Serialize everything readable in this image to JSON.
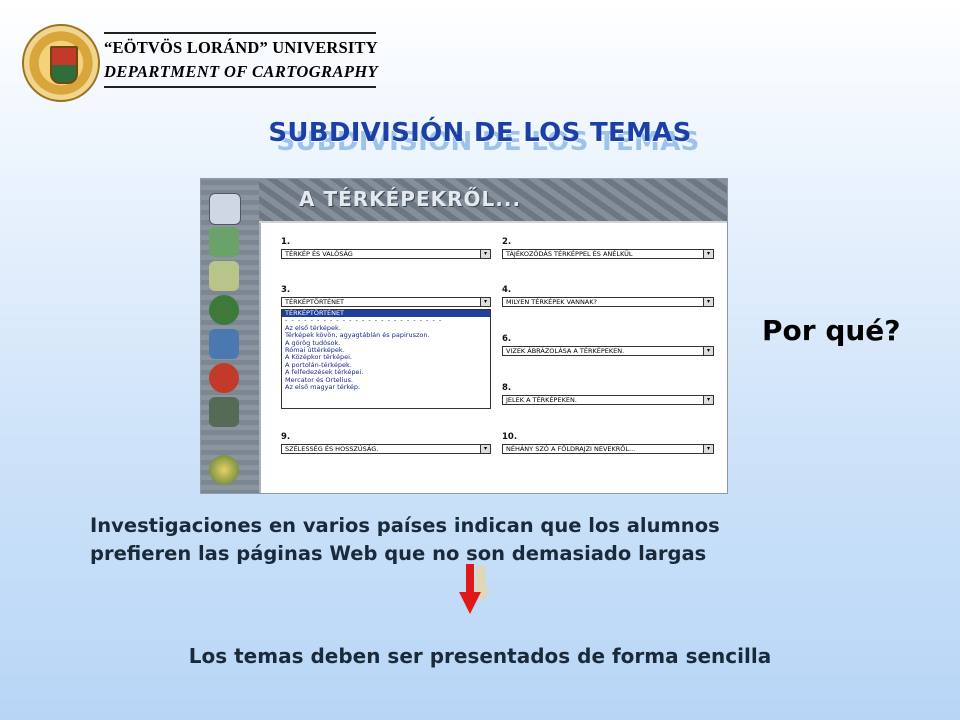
{
  "header": {
    "university": "“EÖTVÖS LORÁND” UNIVERSITY",
    "department": "DEPARTMENT OF CARTOGRAPHY"
  },
  "slide": {
    "title": "SUBDIVISIÓN DE LOS TEMAS",
    "side_question": "Por qué?",
    "paragraph_line1": "Investigaciones en varios países indican que los alumnos",
    "paragraph_line2": "prefieren las páginas Web que no son demasiado largas",
    "conclusion": "Los temas deben ser presentados de forma sencilla"
  },
  "screenshot": {
    "banner": "A TÉRKÉPEKRŐL...",
    "fields": [
      {
        "num": "1.",
        "value": "TÉRKÉP ÉS VALÓSÁG"
      },
      {
        "num": "2.",
        "value": "TÁJÉKOZÓDÁS TÉRKÉPPEL ÉS ANÉLKÜL"
      },
      {
        "num": "3.",
        "value": "TÉRKÉPTÖRTÉNET"
      },
      {
        "num": "4.",
        "value": "MILYEN TÉRKÉPEK VANNAK?"
      },
      {
        "num": "6.",
        "value": "VIZEK ÁBRÁZOLÁSA A TÉRKÉPEKEN."
      },
      {
        "num": "8.",
        "value": "JELEK A TÉRKÉPEKEN."
      },
      {
        "num": "9.",
        "value": "SZÉLESSÉG ÉS HOSSZÚSÁG."
      },
      {
        "num": "10.",
        "value": "NÉHÁNY SZÓ A FÖLDRAJZI NEVEKRŐL..."
      }
    ],
    "dropdown_options": [
      "TÉRKÉPTÖRTÉNET",
      "- - - - - - - - - - - - - - - - - - - - - - - - -",
      "Az első térképek.",
      "Térképek kövön, agyagtáblán és papiruszon.",
      "A görög tudósok.",
      "Római úttérképek.",
      "A Középkor térképei.",
      "A portolán-térképek.",
      "A felfedezések térképei.",
      "Mercator és Ortelius.",
      "Az első magyar térkép."
    ]
  }
}
